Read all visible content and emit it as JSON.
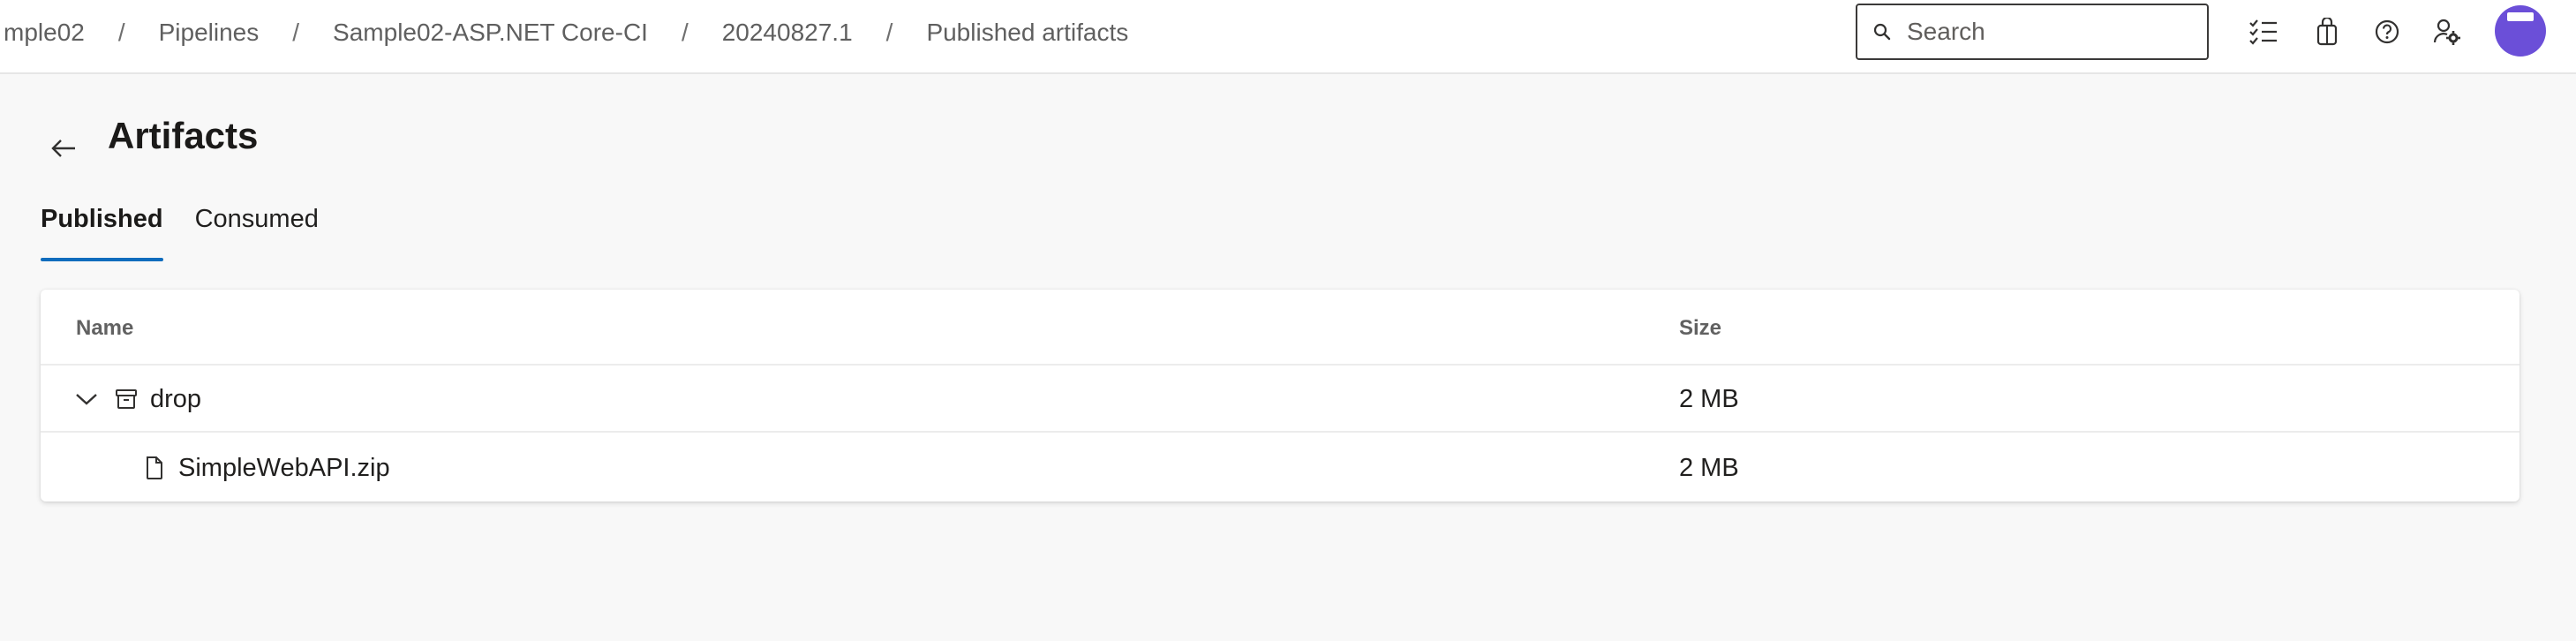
{
  "breadcrumb": {
    "items": [
      "mple02",
      "Pipelines",
      "Sample02-ASP.NET Core-CI",
      "20240827.1",
      "Published artifacts"
    ],
    "separator": "/"
  },
  "search": {
    "placeholder": "Search"
  },
  "toolbar_icons": [
    "task-list-icon",
    "shopping-bag-icon",
    "help-icon",
    "user-settings-icon"
  ],
  "page": {
    "title": "Artifacts"
  },
  "tabs": [
    {
      "label": "Published",
      "active": true
    },
    {
      "label": "Consumed",
      "active": false
    }
  ],
  "table": {
    "columns": [
      "Name",
      "Size"
    ],
    "rows": [
      {
        "name": "drop",
        "size": "2 MB",
        "type": "folder",
        "expanded": true
      },
      {
        "name": "SimpleWebAPI.zip",
        "size": "2 MB",
        "type": "file"
      }
    ]
  },
  "colors": {
    "accent": "#0f6cbd",
    "avatar": "#6b4fd8",
    "background": "#f8f8f8"
  }
}
